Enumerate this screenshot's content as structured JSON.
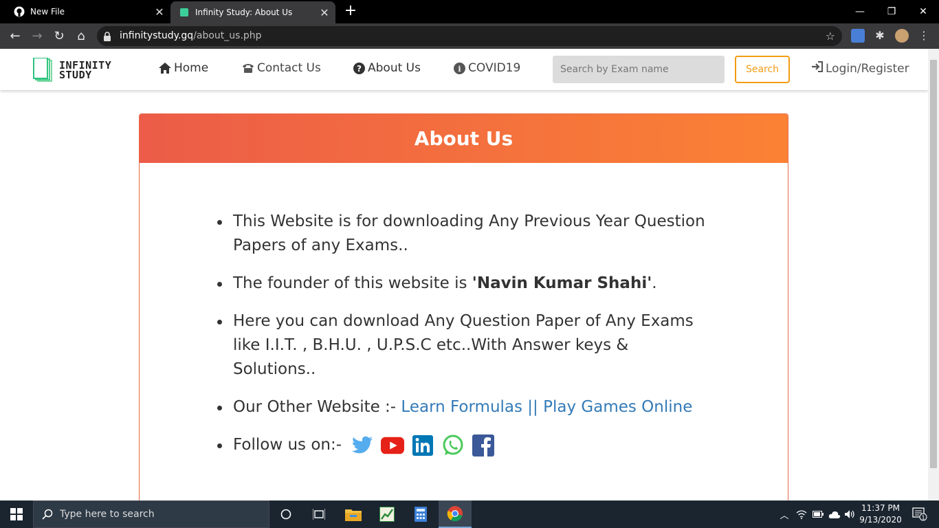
{
  "browser": {
    "tabs": [
      {
        "title": "New File"
      },
      {
        "title": "Infinity Study: About Us"
      }
    ],
    "url_host": "infinitystudy.gq",
    "url_path": "/about_us.php"
  },
  "navbar": {
    "logo_line1": "INFINITY",
    "logo_line2": "STUDY",
    "links": [
      {
        "label": "Home"
      },
      {
        "label": "Contact Us"
      },
      {
        "label": "About Us"
      },
      {
        "label": "COVID19"
      }
    ],
    "search_placeholder": "Search by Exam name",
    "search_button": "Search",
    "login": "Login/Register"
  },
  "about": {
    "title": "About Us",
    "item1": "This Website is for downloading Any Previous Year Question Papers of any Exams..",
    "item2_prefix": "The founder of this website is ",
    "item2_bold": "'Navin Kumar Shahi'",
    "item2_suffix": ".",
    "item3": "Here you can download Any Question Paper of Any Exams like I.I.T. , B.H.U. , U.P.S.C etc..With Answer keys & Solutions..",
    "item4_prefix": "Our Other Website :- ",
    "item4_link1": "Learn Formulas",
    "item4_sep": " || ",
    "item4_link2": "Play Games Online",
    "item5": "Follow us on:-",
    "social_icons": [
      "twitter-icon",
      "youtube-icon",
      "linkedin-icon",
      "whatsapp-icon",
      "facebook-icon"
    ]
  },
  "taskbar": {
    "search_placeholder": "Type here to search",
    "time": "11:37 PM",
    "date": "9/13/2020",
    "notification_count": "1"
  },
  "colors": {
    "header_gradient_start": "#ec5c48",
    "header_gradient_end": "#fb8234",
    "accent": "#f39c12",
    "link": "#337ab7"
  }
}
